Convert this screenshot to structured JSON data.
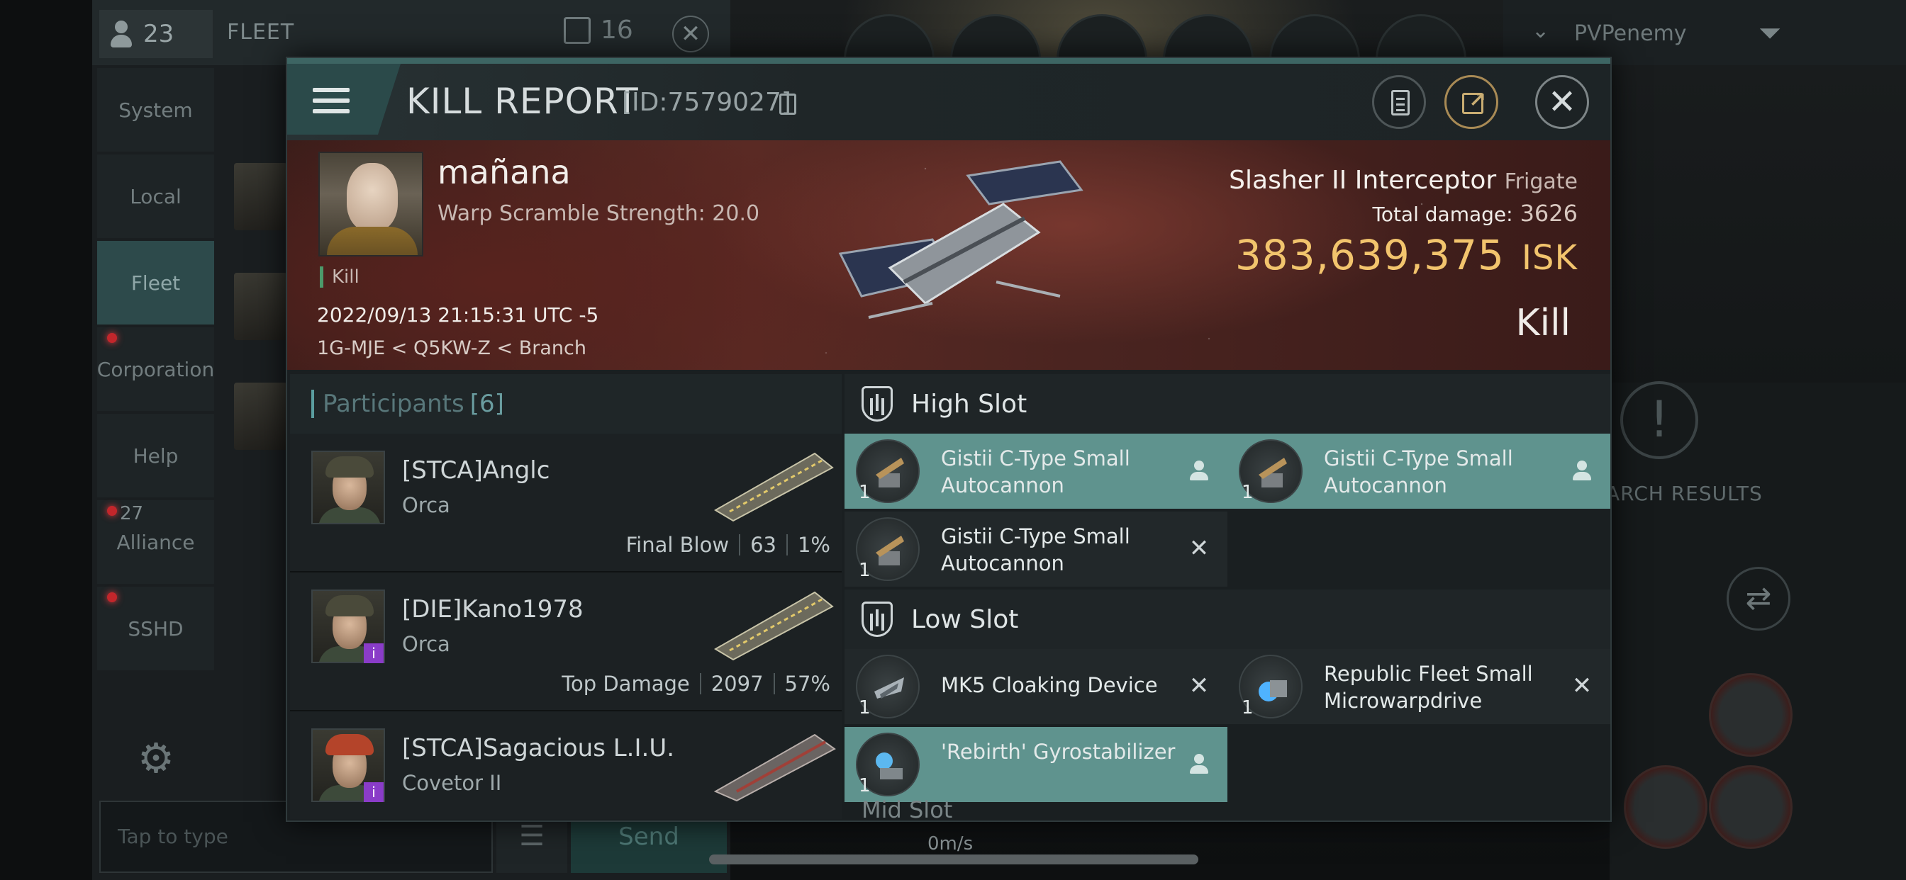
{
  "background": {
    "member_count": "23",
    "fleet_title": "FLEET",
    "chat_count": "16",
    "tabs": [
      {
        "label": "System"
      },
      {
        "label": "Local"
      },
      {
        "label": "Fleet",
        "active": true
      },
      {
        "label": "Corporation",
        "alert": true
      },
      {
        "label": "Help"
      },
      {
        "label": "Alliance",
        "alert": true,
        "count": "27"
      },
      {
        "label": "SSHD",
        "alert": true
      }
    ],
    "chat_placeholder": "Tap to type",
    "send_label": "Send",
    "overview_name": "PVPenemy",
    "search_results": "ARCH RESULTS",
    "speed": "0m/s"
  },
  "modal": {
    "title": "KILL REPORT",
    "report_id": "[ID:7579027]",
    "icons": [
      "document-icon",
      "share-icon",
      "close-icon"
    ]
  },
  "victim": {
    "name": "mañana",
    "subtitle": "Warp Scramble Strength: 20.0",
    "tag": "Kill",
    "timestamp": "2022/09/13 21:15:31 UTC -5",
    "location": "1G-MJE < Q5KW-Z < Branch",
    "ship_name": "Slasher II Interceptor",
    "ship_class": "Frigate",
    "total_damage_label": "Total damage:",
    "total_damage": "3626",
    "isk_value": "383,639,375",
    "isk_unit": "ISK",
    "result": "Kill"
  },
  "participants": {
    "title": "Participants",
    "count": "[6]",
    "rows": [
      {
        "name": "[STCA]Anglc",
        "ship": "Orca",
        "stat_label": "Final Blow",
        "damage": "63",
        "percent": "1%"
      },
      {
        "name": "[DIE]Kano1978",
        "ship": "Orca",
        "stat_label": "Top Damage",
        "damage": "2097",
        "percent": "57%"
      },
      {
        "name": "[STCA]Sagacious L.I.U.",
        "ship": "Covetor II"
      }
    ]
  },
  "fitting": {
    "high_slot_title": "High Slot",
    "low_slot_title": "Low Slot",
    "mid_slot_title": "Mid Slot",
    "high": [
      {
        "name": "Gistii C-Type Small Autocannon",
        "qty": "1",
        "status": "dropped"
      },
      {
        "name": "Gistii C-Type Small Autocannon",
        "qty": "1",
        "status": "dropped"
      },
      {
        "name": "Gistii C-Type Small Autocannon",
        "qty": "1",
        "status": "destroyed"
      }
    ],
    "low": [
      {
        "name": "MK5 Cloaking Device",
        "qty": "1",
        "status": "destroyed"
      },
      {
        "name": "Republic Fleet Small Microwarpdrive",
        "qty": "1",
        "status": "destroyed"
      },
      {
        "name": "'Rebirth' Gyrostabilizer",
        "qty": "1",
        "status": "dropped"
      }
    ]
  }
}
